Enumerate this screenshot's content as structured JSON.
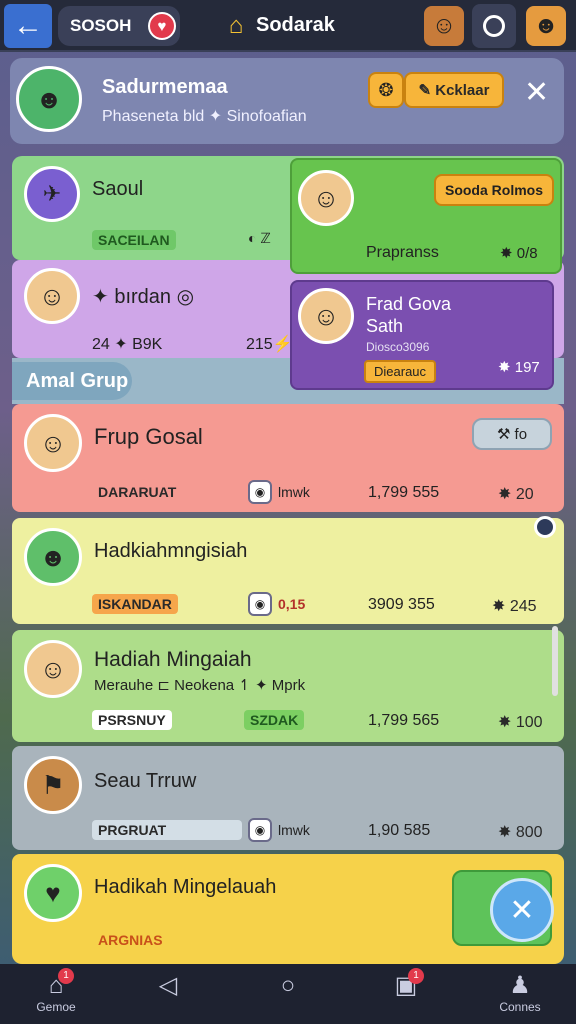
{
  "topbar": {
    "back_icon": "←",
    "brand": "SOSOH",
    "heart_icon": "♥",
    "home_icon": "⌂",
    "title": "Sodarak"
  },
  "profile": {
    "name": "Sadurmemaa",
    "subtitle": "Phasenetа bld ✦ Sinofoafian",
    "coin_icon": "❂",
    "action_label": "✎ Kcklaar",
    "close_icon": "✕"
  },
  "rows": [
    {
      "title": "Saoul",
      "badge": "SACEILAN",
      "note": "◐ ℤ"
    },
    {
      "title": "✦ bırdan ◎",
      "stat": "24 ✦ B9K",
      "value": "215⚡"
    },
    {
      "title": "Frup Gosal",
      "badge": "DARARUAT",
      "status": "lmwk",
      "value": "1,799 555",
      "coins": "✸ 20"
    },
    {
      "title": "Hadkiahmngisiah",
      "badge": "ISKANDAR",
      "status": "0,15",
      "value": "3909 355",
      "coins": "✸ 245"
    },
    {
      "title": "Hadiah Mingaiah",
      "subtitle": "Merauhe ⊏ Neokena ↿ ✦ Mprk",
      "badge": "PSRSNUY",
      "status": "SZDAK",
      "value": "1,799 565",
      "coins": "✸ 100"
    },
    {
      "title": "Seau Trruw",
      "badge": "PRGRUAT",
      "status": "lmwk",
      "value": "1,90 585",
      "coins": "✸ 800"
    },
    {
      "title": "Hadikah Mingelauah",
      "badge": "ARGNIAS"
    }
  ],
  "cards": {
    "green": {
      "button": "Sooda Rolmos",
      "label": "Prapranss",
      "value": "✸ 0/8"
    },
    "purple": {
      "line1": "Frad Gova",
      "line2": "Sath",
      "line3": "Diosco3096",
      "badge": "Diearauc",
      "value": "✸ 197"
    }
  },
  "section_label": "Amal Grup",
  "sort_button": "⚒ fo",
  "fab_icon": "✕",
  "nav": [
    {
      "label": "Gemoe",
      "icon": "⌂",
      "badge": "1"
    },
    {
      "label": "",
      "icon": "◁"
    },
    {
      "label": "",
      "icon": "○"
    },
    {
      "label": "",
      "icon": "▣",
      "badge": "1"
    },
    {
      "label": "Connes",
      "icon": "♟"
    }
  ]
}
